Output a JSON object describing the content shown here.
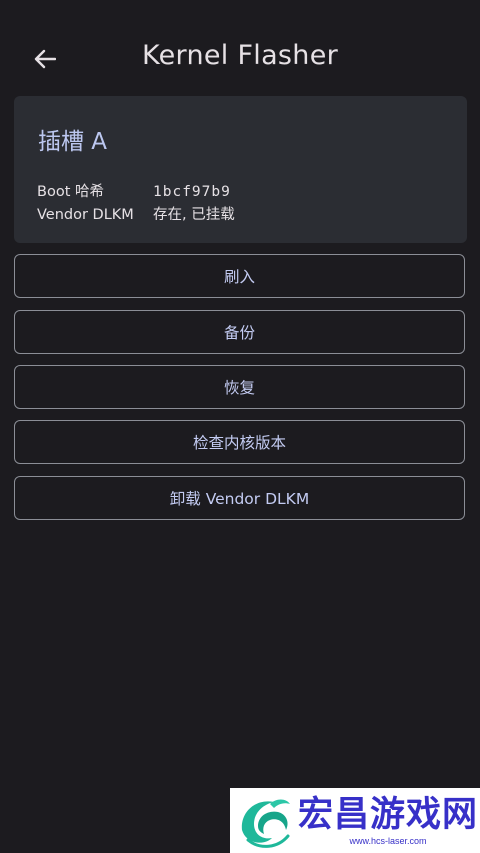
{
  "app_bar": {
    "title": "Kernel Flasher",
    "back_icon": "arrow-back-icon"
  },
  "slot_card": {
    "title": "插槽 A",
    "rows": [
      {
        "label": "Boot 哈希",
        "value": "1bcf97b9"
      },
      {
        "label": "Vendor DLKM",
        "value": "存在, 已挂载"
      }
    ]
  },
  "actions": [
    {
      "label": "刷入"
    },
    {
      "label": "备份"
    },
    {
      "label": "恢复"
    },
    {
      "label": "检查内核版本"
    },
    {
      "label": "卸载 Vendor DLKM"
    }
  ],
  "watermark": {
    "name": "宏昌游戏网",
    "url": "www.hcs-laser.com"
  },
  "colors": {
    "background": "#1c1b1f",
    "card": "#2b2d33",
    "accent": "#bcc7f0",
    "button_border": "#8b8e96",
    "watermark_text": "#3730c8"
  }
}
